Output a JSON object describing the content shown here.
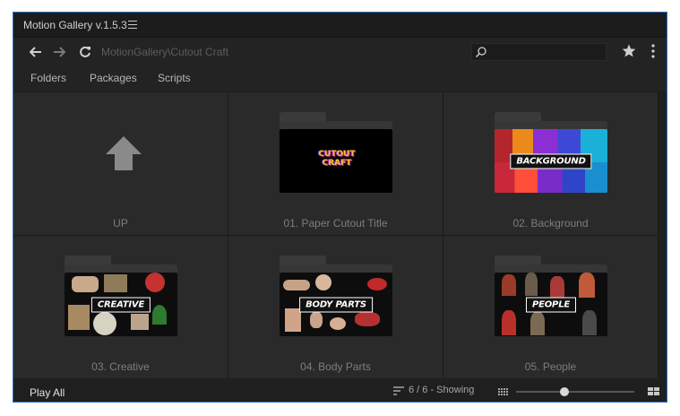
{
  "window": {
    "title": "Motion Gallery v.1.5.3"
  },
  "toolbar": {
    "path": "MotionGallery\\Cutout Craft",
    "search": {
      "value": "",
      "placeholder": ""
    }
  },
  "tabs": [
    {
      "label": "Folders"
    },
    {
      "label": "Packages"
    },
    {
      "label": "Scripts"
    }
  ],
  "items": [
    {
      "label": "UP",
      "icon": "up-arrow-icon"
    },
    {
      "label": "01. Paper Cutout Title",
      "thumb_text": "CUTOUT CRAFT"
    },
    {
      "label": "02. Background",
      "thumb_text": "BACKGROUND"
    },
    {
      "label": "03. Creative",
      "thumb_text": "CREATIVE"
    },
    {
      "label": "04. Body Parts",
      "thumb_text": "BODY PARTS"
    },
    {
      "label": "05. People",
      "thumb_text": "PEOPLE"
    }
  ],
  "footer": {
    "play_all": "Play All",
    "count": "6 / 6 - Showing",
    "zoom_level": 0.41
  },
  "colors": {
    "accent": "#2f73c7",
    "panel": "#2a2a2a",
    "background": "#232323"
  }
}
